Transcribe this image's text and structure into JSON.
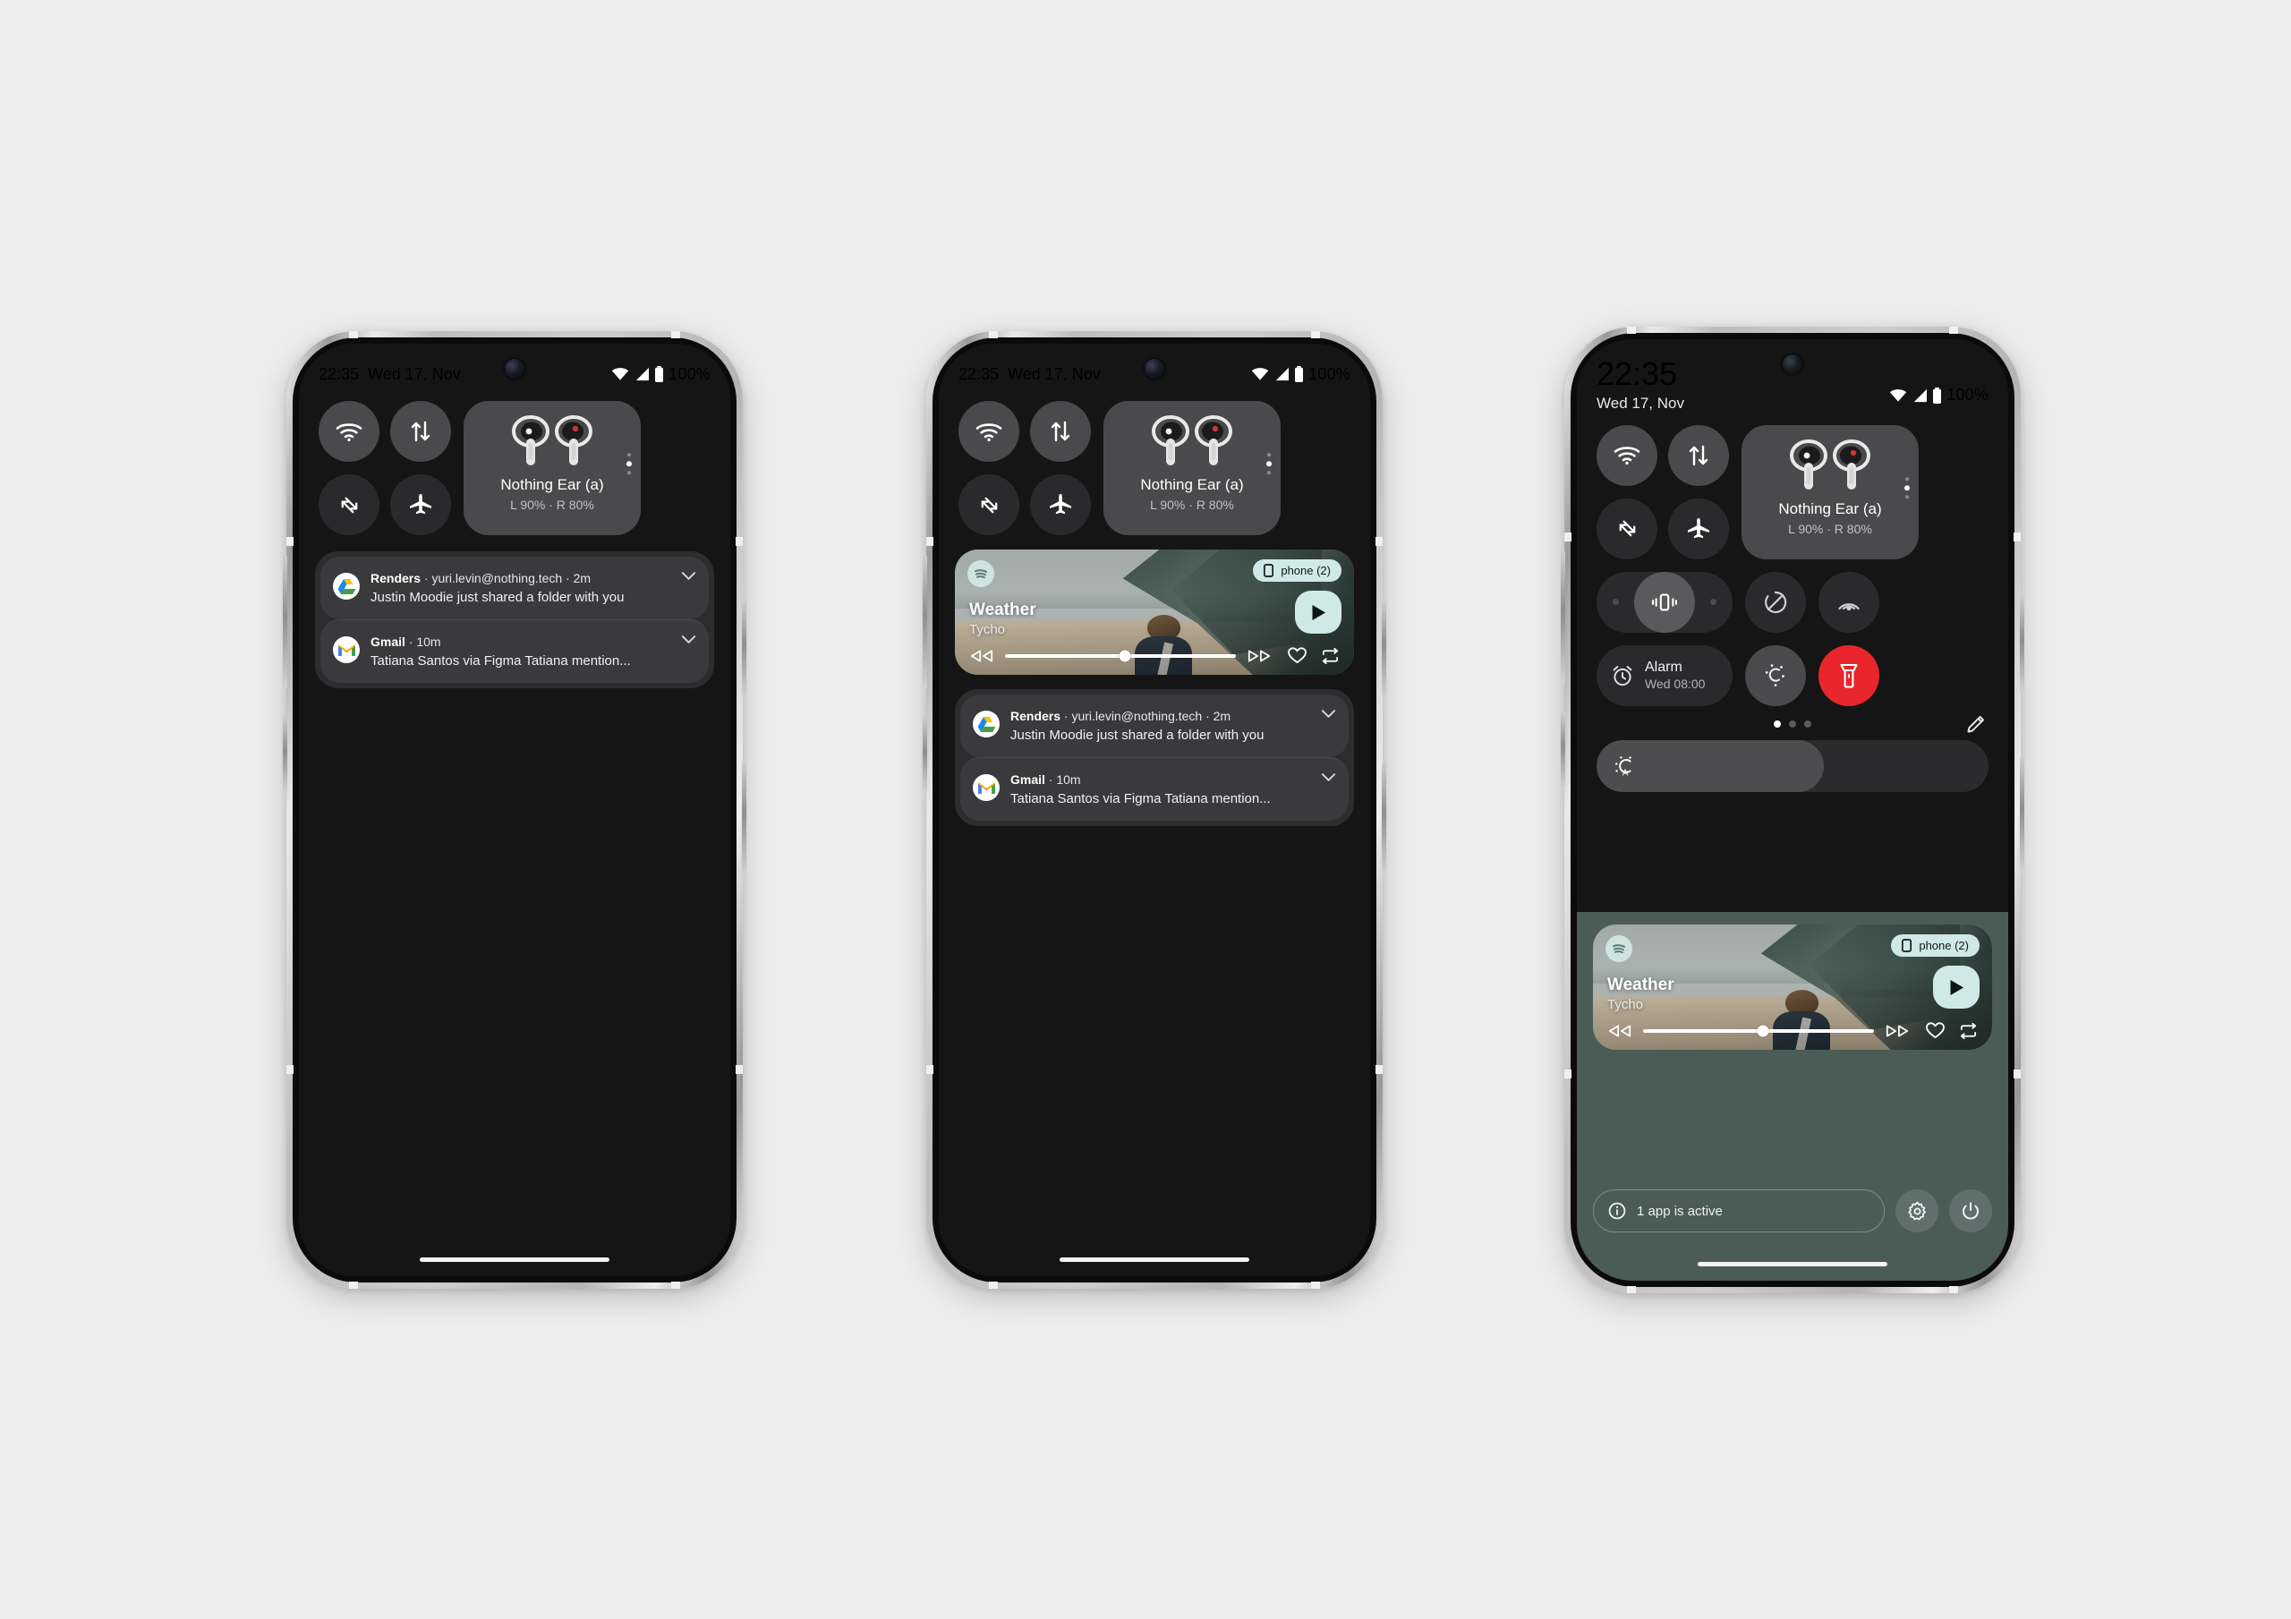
{
  "page": {
    "background": "#ededed",
    "accent_red": "#e8262b",
    "accent_mint": "#cfe9e6"
  },
  "status_bar": {
    "time": "22:35",
    "date": "Wed 17, Nov",
    "battery_percent": "100%",
    "icons": [
      "wifi-icon",
      "cellular-signal-icon",
      "battery-icon"
    ]
  },
  "quick_tiles": {
    "wifi": {
      "name": "wifi-tile",
      "icon": "wifi-icon",
      "state": "on"
    },
    "data": {
      "name": "mobile-data-tile",
      "icon": "data-transfer-icon",
      "state": "on"
    },
    "rotate": {
      "name": "auto-rotate-tile",
      "icon": "auto-rotate-icon",
      "state": "off"
    },
    "airplane": {
      "name": "airplane-mode-tile",
      "icon": "airplane-icon",
      "state": "off"
    }
  },
  "bluetooth_card": {
    "device_name": "Nothing Ear (a)",
    "battery_levels": "L 90% · R 80%",
    "icon": "earbuds-icon",
    "page_dots": 3,
    "active_dot": 1
  },
  "extra_tiles": {
    "vibrate": {
      "label": "",
      "icon": "vibrate-icon",
      "state": "selected"
    },
    "dnd": {
      "label": "",
      "icon": "do-not-disturb-icon",
      "state": "off"
    },
    "cast": {
      "label": "",
      "icon": "cast-signal-icon",
      "state": "off"
    },
    "alarm": {
      "title": "Alarm",
      "subtitle": "Wed 08:00",
      "icon": "alarm-clock-icon"
    },
    "temperature": {
      "label": "",
      "icon": "color-temperature-icon"
    },
    "flashlight": {
      "label": "",
      "icon": "flashlight-icon",
      "state": "on",
      "color": "#e8262b"
    }
  },
  "page_indicator": {
    "count": 3,
    "active": 0
  },
  "edit_button": {
    "icon": "pencil-edit-icon"
  },
  "brightness": {
    "icon": "auto-brightness-icon",
    "level_percent": 58
  },
  "media_player": {
    "app_icon": "spotify-icon",
    "output_chip": {
      "icon": "phone-device-icon",
      "label": "phone (2)"
    },
    "track_title": "Weather",
    "artist": "Tycho",
    "play_button": {
      "icon": "play-icon"
    },
    "controls": [
      {
        "name": "rewind-button",
        "icon": "rewind-icon"
      },
      {
        "name": "seek-bar",
        "icon": "seek-slider",
        "progress_percent": 52
      },
      {
        "name": "fast-forward-button",
        "icon": "fast-forward-icon"
      },
      {
        "name": "favorite-button",
        "icon": "heart-icon"
      },
      {
        "name": "repeat-button",
        "icon": "repeat-icon"
      }
    ]
  },
  "notifications": [
    {
      "app": "Renders",
      "meta": "· yuri.levin@nothing.tech · 2m",
      "text": "Justin Moodie just shared a folder with you",
      "icon": "google-drive-icon",
      "expand_icon": "chevron-down-icon"
    },
    {
      "app": "Gmail",
      "meta": "· 10m",
      "text": "Tatiana Santos via Figma Tatiana mention...",
      "icon": "gmail-icon",
      "expand_icon": "chevron-down-icon"
    }
  ],
  "footer": {
    "active_apps": {
      "icon": "info-icon",
      "label": "1 app is active"
    },
    "settings": {
      "icon": "gear-icon"
    },
    "power": {
      "icon": "power-icon"
    }
  }
}
